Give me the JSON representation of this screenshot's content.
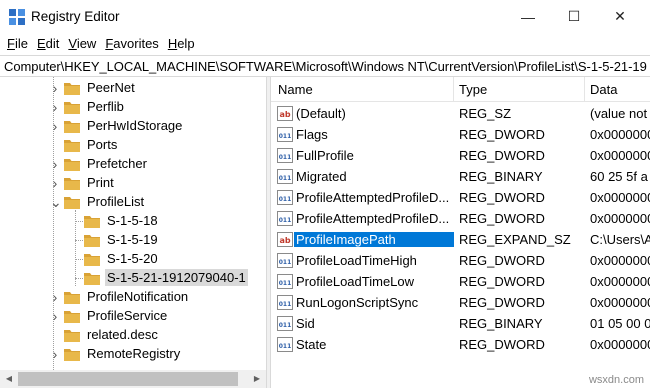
{
  "window": {
    "title": "Registry Editor",
    "minimize_glyph": "—",
    "maximize_glyph": "☐",
    "close_glyph": "✕"
  },
  "menu": [
    "File",
    "Edit",
    "View",
    "Favorites",
    "Help"
  ],
  "address": "Computer\\HKEY_LOCAL_MACHINE\\SOFTWARE\\Microsoft\\Windows NT\\CurrentVersion\\ProfileList\\S-1-5-21-19",
  "tree": {
    "items": [
      {
        "label": "PeerNet",
        "expander": ">"
      },
      {
        "label": "Perflib",
        "expander": ">"
      },
      {
        "label": "PerHwIdStorage",
        "expander": ">"
      },
      {
        "label": "Ports",
        "expander": ""
      },
      {
        "label": "Prefetcher",
        "expander": ">"
      },
      {
        "label": "Print",
        "expander": ">"
      },
      {
        "label": "ProfileList",
        "expander": "v"
      },
      {
        "label": "S-1-5-18",
        "expander": ""
      },
      {
        "label": "S-1-5-19",
        "expander": ""
      },
      {
        "label": "S-1-5-20",
        "expander": ""
      },
      {
        "label": "S-1-5-21-1912079040-1",
        "expander": ""
      },
      {
        "label": "ProfileNotification",
        "expander": ">"
      },
      {
        "label": "ProfileService",
        "expander": ">"
      },
      {
        "label": "related.desc",
        "expander": ""
      },
      {
        "label": "RemoteRegistry",
        "expander": ">"
      }
    ],
    "selected_index": 10
  },
  "list": {
    "columns": [
      "Name",
      "Type",
      "Data"
    ],
    "rows": [
      {
        "icon": "string-value-icon",
        "name": "(Default)",
        "type": "REG_SZ",
        "data": "(value not"
      },
      {
        "icon": "binary-value-icon",
        "name": "Flags",
        "type": "REG_DWORD",
        "data": "0x0000000"
      },
      {
        "icon": "binary-value-icon",
        "name": "FullProfile",
        "type": "REG_DWORD",
        "data": "0x0000000"
      },
      {
        "icon": "binary-value-icon",
        "name": "Migrated",
        "type": "REG_BINARY",
        "data": "60 25 5f a"
      },
      {
        "icon": "binary-value-icon",
        "name": "ProfileAttemptedProfileD...",
        "type": "REG_DWORD",
        "data": "0x0000000"
      },
      {
        "icon": "binary-value-icon",
        "name": "ProfileAttemptedProfileD...",
        "type": "REG_DWORD",
        "data": "0x0000000"
      },
      {
        "icon": "string-value-icon",
        "name": "ProfileImagePath",
        "type": "REG_EXPAND_SZ",
        "data": "C:\\Users\\A"
      },
      {
        "icon": "binary-value-icon",
        "name": "ProfileLoadTimeHigh",
        "type": "REG_DWORD",
        "data": "0x0000000"
      },
      {
        "icon": "binary-value-icon",
        "name": "ProfileLoadTimeLow",
        "type": "REG_DWORD",
        "data": "0x0000000"
      },
      {
        "icon": "binary-value-icon",
        "name": "RunLogonScriptSync",
        "type": "REG_DWORD",
        "data": "0x0000000"
      },
      {
        "icon": "binary-value-icon",
        "name": "Sid",
        "type": "REG_BINARY",
        "data": "01 05 00 0"
      },
      {
        "icon": "binary-value-icon",
        "name": "State",
        "type": "REG_DWORD",
        "data": "0x0000000"
      }
    ],
    "selected_index": 6
  },
  "watermark": "wsxdn.com",
  "colors": {
    "selection": "#0078d7",
    "folder": "#e8b84a",
    "string_icon": "#c0392b",
    "binary_icon": "#2e5fa8"
  }
}
